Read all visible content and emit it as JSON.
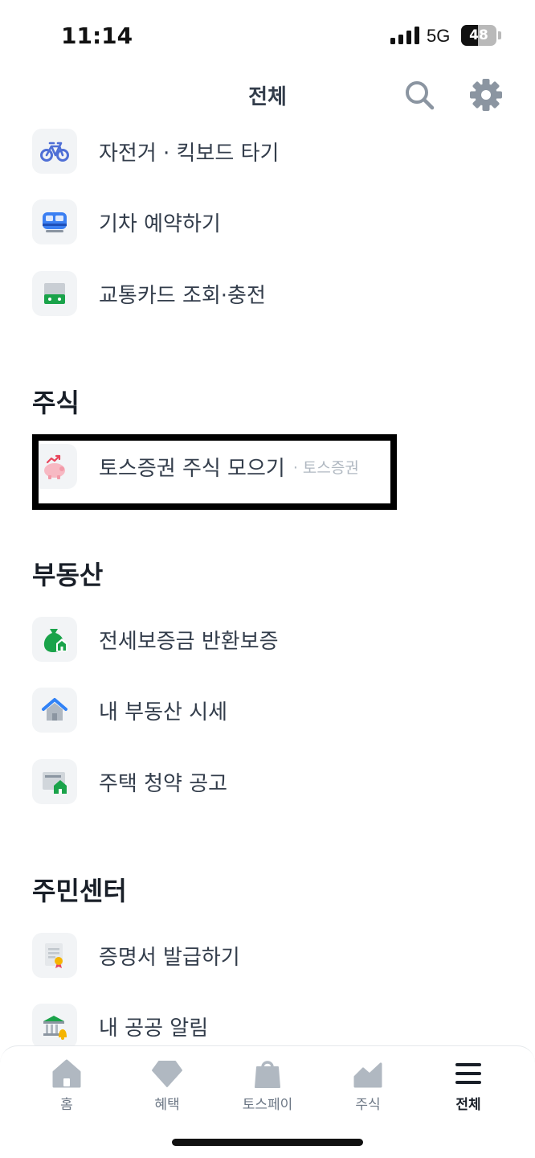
{
  "status_bar": {
    "time": "11:14",
    "network": "5G",
    "battery": 48
  },
  "header": {
    "title": "전체",
    "search_icon": "search-icon",
    "settings_icon": "gear-icon"
  },
  "transport": {
    "items": [
      {
        "label": "자전거 · 킥보드 타기",
        "icon": "bicycle-icon"
      },
      {
        "label": "기차 예약하기",
        "icon": "train-icon"
      },
      {
        "label": "교통카드 조회·충전",
        "icon": "transit-card-icon"
      }
    ]
  },
  "stocks": {
    "title": "주식",
    "items": [
      {
        "label": "토스증권 주식 모으기",
        "sublabel": "· 토스증권",
        "icon": "piggy-bank-icon"
      }
    ]
  },
  "real_estate": {
    "title": "부동산",
    "items": [
      {
        "label": "전세보증금 반환보증",
        "icon": "money-bag-house-icon"
      },
      {
        "label": "내 부동산 시세",
        "icon": "house-icon"
      },
      {
        "label": "주택 청약 공고",
        "icon": "housing-notice-icon"
      }
    ]
  },
  "civil": {
    "title": "주민센터",
    "items": [
      {
        "label": "증명서 발급하기",
        "icon": "certificate-icon"
      },
      {
        "label": "내 공공 알림",
        "icon": "public-building-bell-icon"
      }
    ]
  },
  "tabs": [
    {
      "label": "홈",
      "icon": "home-icon",
      "active": false
    },
    {
      "label": "혜택",
      "icon": "gem-icon",
      "active": false
    },
    {
      "label": "토스페이",
      "icon": "shopping-bag-icon",
      "active": false
    },
    {
      "label": "주식",
      "icon": "stock-chart-icon",
      "active": false
    },
    {
      "label": "전체",
      "icon": "menu-icon",
      "active": true
    }
  ],
  "colors": {
    "accent": "#3182f6",
    "text": "#333d4b",
    "icon_bg": "#f2f4f6",
    "green": "#1aa34a"
  }
}
